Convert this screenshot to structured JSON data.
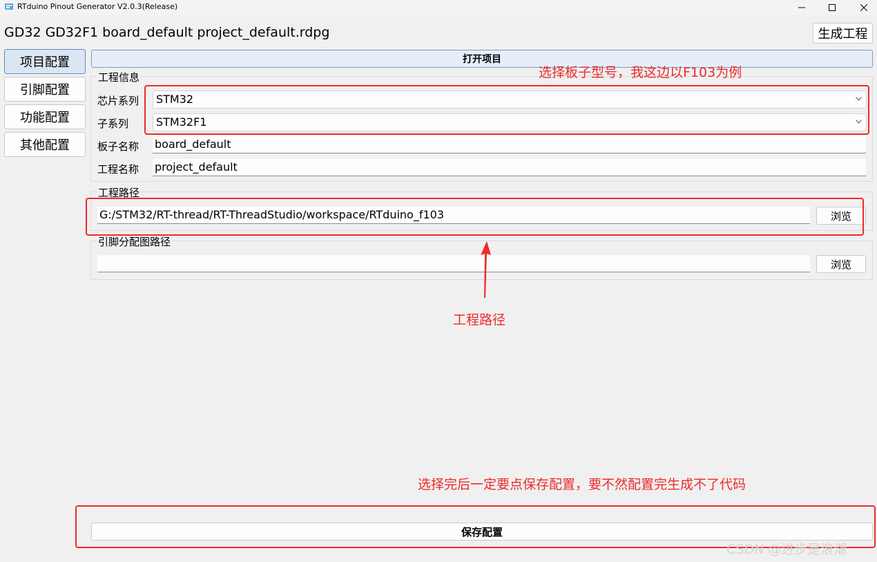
{
  "window": {
    "title": "RTduino Pinout Generator V2.0.3(Release)",
    "app_icon": "rtduino-app-icon"
  },
  "header": {
    "project_title": "GD32 GD32F1 board_default project_default.rdpg",
    "generate_label": "生成工程"
  },
  "sidebar": {
    "items": [
      {
        "label": "项目配置",
        "active": true
      },
      {
        "label": "引脚配置",
        "active": false
      },
      {
        "label": "功能配置",
        "active": false
      },
      {
        "label": "其他配置",
        "active": false
      }
    ]
  },
  "main": {
    "open_project_label": "打开项目",
    "project_info": {
      "group_title": "工程信息",
      "chip_series_label": "芯片系列",
      "chip_series_value": "STM32",
      "sub_series_label": "子系列",
      "sub_series_value": "STM32F1",
      "board_name_label": "板子名称",
      "board_name_value": "board_default",
      "project_name_label": "工程名称",
      "project_name_value": "project_default"
    },
    "project_path": {
      "group_title": "工程路径",
      "value": "G:/STM32/RT-thread/RT-ThreadStudio/workspace/RTduino_f103",
      "browse_label": "浏览"
    },
    "pinmap_path": {
      "group_title": "引脚分配图路径",
      "value": "",
      "browse_label": "浏览"
    },
    "save_label": "保存配置"
  },
  "annotations": {
    "board_note": "选择板子型号，我这边以F103为例",
    "path_note": "工程路径",
    "save_note": "选择完后一定要点保存配置，要不然配置完生成不了代码",
    "color": "#ef2a2a"
  },
  "watermark": "CSDN @进步是浪潮"
}
